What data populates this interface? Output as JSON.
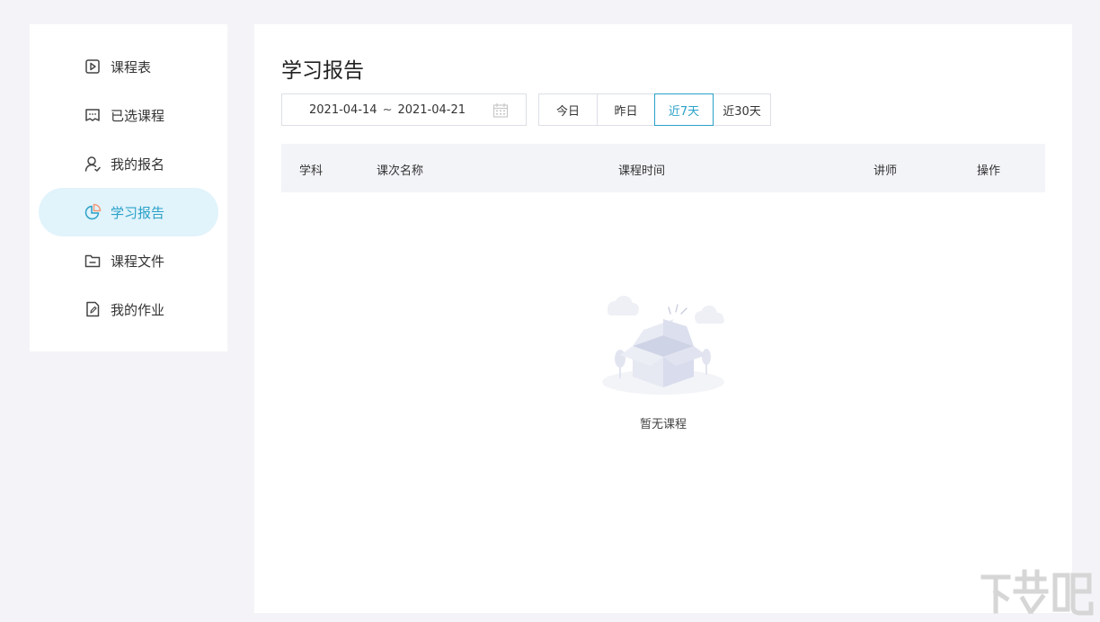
{
  "sidebar": {
    "items": [
      {
        "label": "课程表",
        "icon": "play-square-icon"
      },
      {
        "label": "已选课程",
        "icon": "chat-box-icon"
      },
      {
        "label": "我的报名",
        "icon": "user-icon"
      },
      {
        "label": "学习报告",
        "icon": "pie-chart-icon",
        "active": true
      },
      {
        "label": "课程文件",
        "icon": "folder-icon"
      },
      {
        "label": "我的作业",
        "icon": "edit-document-icon"
      }
    ]
  },
  "main": {
    "title": "学习报告",
    "date_range": {
      "start": "2021-04-14",
      "separator": "~",
      "end": "2021-04-21"
    },
    "quick_ranges": [
      "今日",
      "昨日",
      "近7天",
      "近30天"
    ],
    "active_range": "近7天",
    "table": {
      "columns": [
        "学科",
        "课次名称",
        "课程时间",
        "讲师",
        "操作"
      ]
    },
    "empty_text": "暂无课程"
  },
  "colors": {
    "accent": "#2aa1c8",
    "active_bg": "#e1f3fb",
    "page_bg": "#f4f4f8",
    "table_head_bg": "#f3f4f8"
  }
}
